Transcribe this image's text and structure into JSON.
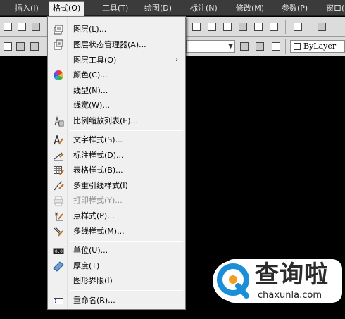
{
  "menubar": {
    "items": [
      {
        "label": "插入(I)"
      },
      {
        "label": "格式(O)"
      },
      {
        "label": "工具(T)"
      },
      {
        "label": "绘图(D)"
      },
      {
        "label": "标注(N)"
      },
      {
        "label": "修改(M)"
      },
      {
        "label": "参数(P)"
      },
      {
        "label": "窗口("
      }
    ]
  },
  "properties": {
    "linetype_value": "ByLayer"
  },
  "format_menu": {
    "items": [
      {
        "label": "图层(L)...",
        "icon": "layers-icon"
      },
      {
        "label": "图层状态管理器(A)...",
        "icon": "layer-state-icon"
      },
      {
        "label": "图层工具(O)",
        "submenu_arrow": "›"
      },
      {
        "label": "颜色(C)...",
        "icon": "color-wheel-icon"
      },
      {
        "label": "线型(N)..."
      },
      {
        "label": "线宽(W)..."
      },
      {
        "label": "比例缩放列表(E)...",
        "icon": "scale-list-icon"
      },
      {
        "label": "文字样式(S)...",
        "icon": "text-style-icon"
      },
      {
        "label": "标注样式(D)...",
        "icon": "dimension-style-icon"
      },
      {
        "label": "表格样式(B)...",
        "icon": "table-style-icon"
      },
      {
        "label": "多重引线样式(I)",
        "icon": "multileader-style-icon"
      },
      {
        "label": "打印样式(Y)...",
        "icon": "plot-style-icon"
      },
      {
        "label": "点样式(P)...",
        "icon": "point-style-icon"
      },
      {
        "label": "多线样式(M)...",
        "icon": "multiline-style-icon"
      },
      {
        "label": "单位(U)...",
        "icon": "units-icon"
      },
      {
        "label": "厚度(T)",
        "icon": "thickness-icon"
      },
      {
        "label": "图形界限(I)"
      },
      {
        "label": "重命名(R)...",
        "icon": "rename-icon"
      }
    ]
  },
  "watermark": {
    "cn": "查询啦",
    "url": "chaxunla.com"
  },
  "colors": {
    "menubar_bg": "#3b3b3b",
    "menu_bg": "#f0f0f0",
    "toolbar_bg": "#dcdcdc",
    "canvas_bg": "#000000",
    "watermark_blue": "#1a8fd8"
  }
}
